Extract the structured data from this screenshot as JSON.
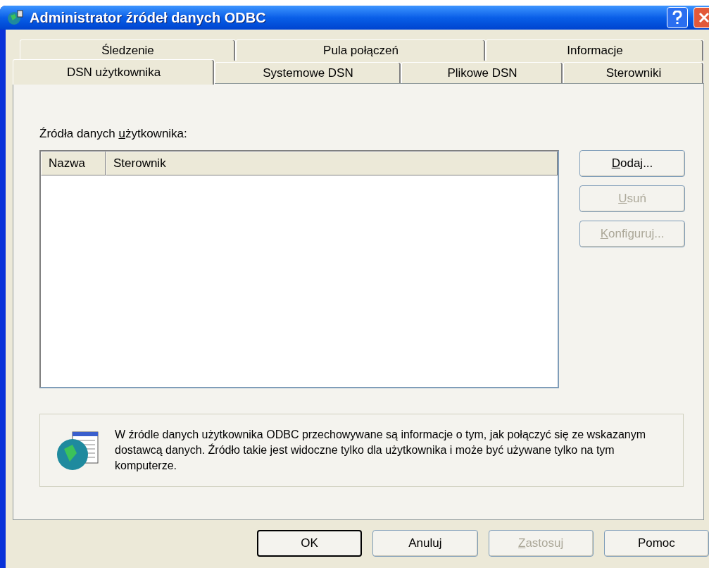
{
  "window": {
    "title": "Administrator źródeł danych ODBC"
  },
  "tab_rows": [
    [
      {
        "label": "Śledzenie",
        "selected": false
      },
      {
        "label": "Pula połączeń",
        "selected": false
      },
      {
        "label": "Informacje",
        "selected": false
      }
    ],
    [
      {
        "label": "DSN użytkownika",
        "selected": true
      },
      {
        "label": "Systemowe DSN",
        "selected": false
      },
      {
        "label": "Plikowe DSN",
        "selected": false
      },
      {
        "label": "Sterowniki",
        "selected": false
      }
    ]
  ],
  "list_label": {
    "parts": [
      {
        "text": "Źródła danych ",
        "underlined": false
      },
      {
        "text": "u",
        "underlined": true
      },
      {
        "text": "żytkownika:",
        "underlined": false
      }
    ]
  },
  "table": {
    "columns": [
      "Nazwa",
      "Sterownik"
    ]
  },
  "side_buttons": [
    {
      "parts": [
        {
          "text": "D",
          "underlined": true
        },
        {
          "text": "odaj...",
          "underlined": false
        }
      ],
      "disabled": false
    },
    {
      "parts": [
        {
          "text": "U",
          "underlined": true
        },
        {
          "text": "suń",
          "underlined": false
        }
      ],
      "disabled": true
    },
    {
      "parts": [
        {
          "text": "K",
          "underlined": true
        },
        {
          "text": "onfiguruj...",
          "underlined": false
        }
      ],
      "disabled": true
    }
  ],
  "info": "W źródle danych użytkownika ODBC przechowywane są informacje o tym, jak połączyć się ze wskazanym dostawcą danych. Źródło takie jest widoczne tylko dla użytkownika i może być używane tylko na tym komputerze.",
  "buttons": [
    {
      "parts": [
        {
          "text": "OK",
          "underlined": false
        }
      ],
      "disabled": false,
      "default": true
    },
    {
      "parts": [
        {
          "text": "Anuluj",
          "underlined": false
        }
      ],
      "disabled": false,
      "default": false
    },
    {
      "parts": [
        {
          "text": "Z",
          "underlined": true
        },
        {
          "text": "astosuj",
          "underlined": false
        }
      ],
      "disabled": true,
      "default": false
    },
    {
      "parts": [
        {
          "text": "Pomoc",
          "underlined": false
        }
      ],
      "disabled": false,
      "default": false
    }
  ]
}
